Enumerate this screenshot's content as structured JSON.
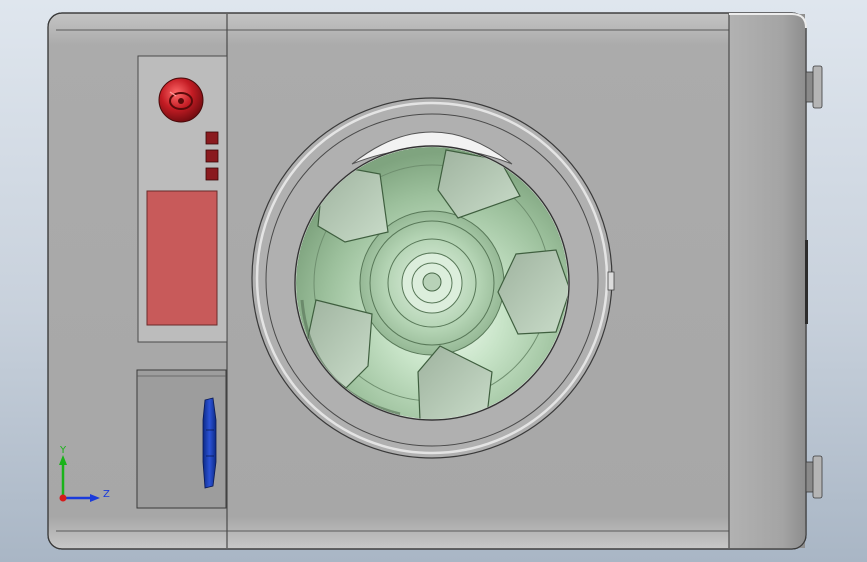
{
  "viewport": {
    "background_top": "#dfe6ee",
    "background_bottom": "#a9b6c5"
  },
  "model": {
    "body_color": "#a9a9a9",
    "panel_color": "#b9b9b9",
    "display_color": "#c85a5a",
    "knob_color": "#b0151c",
    "indicator_count": 3,
    "drum_glass_color": "#b9d6b9",
    "drawer_handle_color": "#1f3fb0"
  },
  "triad": {
    "y_label": "Y",
    "z_label": "Z",
    "y_color": "#1ab31a",
    "z_color": "#1a3adb",
    "origin_color": "#d61a1a"
  }
}
